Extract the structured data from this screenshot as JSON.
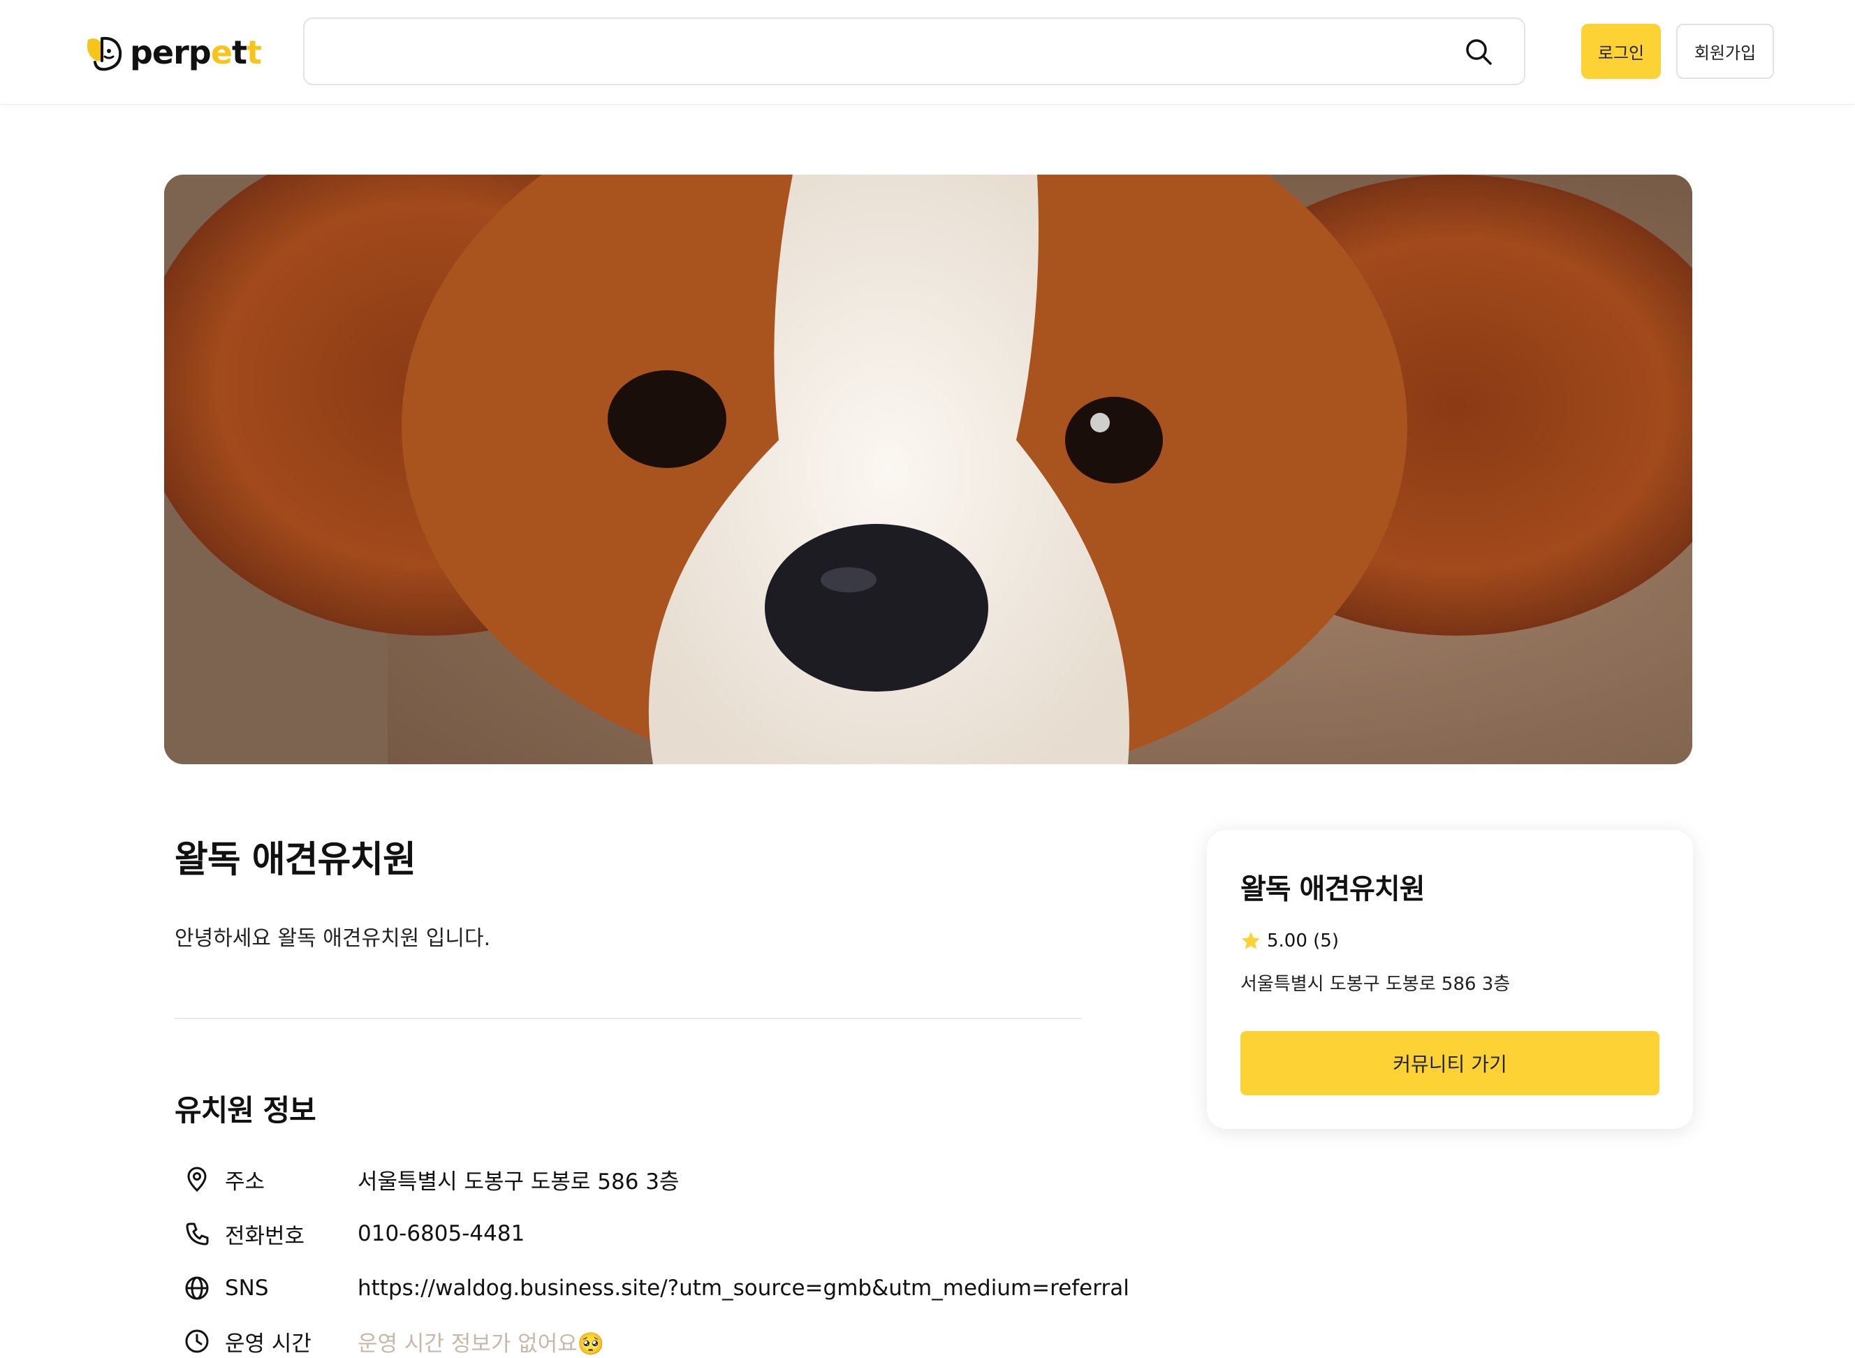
{
  "header": {
    "logo_text_1": "perp",
    "logo_text_2": "e",
    "logo_text_3": "t",
    "logo_text_4": "t",
    "search_value": "",
    "search_placeholder": "",
    "login_label": "로그인",
    "signup_label": "회원가입"
  },
  "kindergarten": {
    "name": "왈독 애견유치원",
    "intro": "안녕하세요 왈독 애견유치원 입니다.",
    "section_title": "유치원 정보",
    "info": [
      {
        "icon": "location-pin-icon",
        "label": "주소",
        "value": "서울특별시 도봉구 도봉로 586 3층"
      },
      {
        "icon": "phone-icon",
        "label": "전화번호",
        "value": "010-6805-4481"
      },
      {
        "icon": "globe-icon",
        "label": "SNS",
        "value": "https://waldog.business.site/?utm_source=gmb&utm_medium=referral"
      },
      {
        "icon": "clock-icon",
        "label": "운영 시간",
        "value": "운영 시간 정보가 없어요🥺"
      }
    ]
  },
  "card": {
    "title": "왈독 애견유치원",
    "rating": "5.00 (5)",
    "address": "서울특별시 도봉구 도봉로 586 3층",
    "button_label": "커뮤니티 가기"
  },
  "colors": {
    "accent": "#fdd235",
    "muted_text": "#c9b8a7"
  }
}
